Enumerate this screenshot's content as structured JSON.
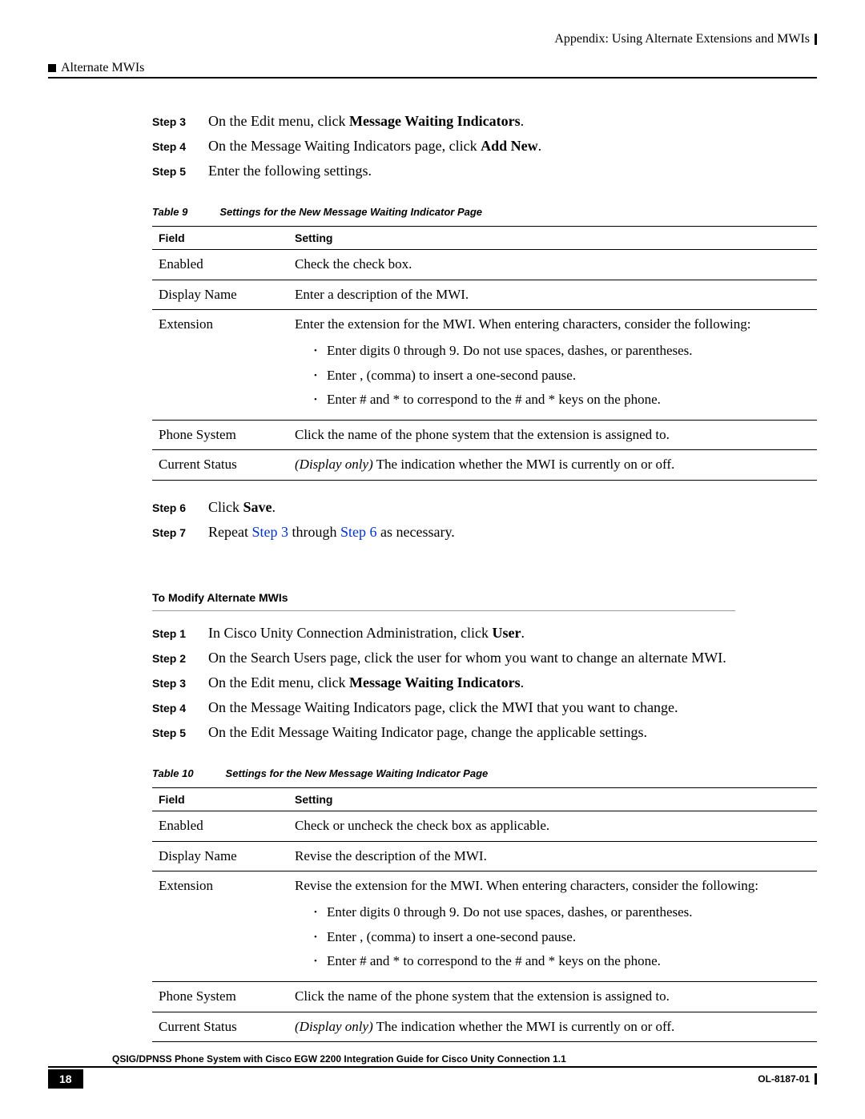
{
  "header": {
    "appendix": "Appendix: Using Alternate Extensions and MWIs",
    "section": "Alternate MWIs"
  },
  "steps_top": [
    {
      "label": "Step 3",
      "prefix": "On the Edit menu, click ",
      "bold": "Message Waiting Indicators",
      "suffix": "."
    },
    {
      "label": "Step 4",
      "prefix": "On the Message Waiting Indicators page, click ",
      "bold": "Add New",
      "suffix": "."
    },
    {
      "label": "Step 5",
      "prefix": "Enter the following settings.",
      "bold": "",
      "suffix": ""
    }
  ],
  "table9": {
    "caption_label": "Table 9",
    "caption": "Settings for the New Message Waiting Indicator Page",
    "head_field": "Field",
    "head_setting": "Setting",
    "rows": {
      "enabled": {
        "f": "Enabled",
        "s": "Check the check box."
      },
      "display": {
        "f": "Display Name",
        "s": "Enter a description of the MWI."
      },
      "ext": {
        "f": "Extension",
        "intro": "Enter the extension for the MWI. When entering characters, consider the following:",
        "b1": "Enter digits 0 through 9. Do not use spaces, dashes, or parentheses.",
        "b2": "Enter , (comma) to insert a one-second pause.",
        "b3": "Enter # and * to correspond to the # and * keys on the phone."
      },
      "phone": {
        "f": "Phone System",
        "s": "Click the name of the phone system that the extension is assigned to."
      },
      "status": {
        "f": "Current Status",
        "italic": "(Display only)",
        "rest": " The indication whether the MWI is currently on or off."
      }
    }
  },
  "steps_after_t9": {
    "s6": {
      "label": "Step 6",
      "prefix": "Click ",
      "bold": "Save",
      "suffix": "."
    },
    "s7": {
      "label": "Step 7",
      "prefix": "Repeat ",
      "link1": "Step 3",
      "mid": " through ",
      "link2": "Step 6",
      "suffix": " as necessary."
    }
  },
  "section2": {
    "heading": "To Modify Alternate MWIs",
    "steps": [
      {
        "label": "Step 1",
        "prefix": "In Cisco Unity Connection Administration, click ",
        "bold": "User",
        "suffix": "."
      },
      {
        "label": "Step 2",
        "prefix": "On the Search Users page, click the user for whom you want to change an alternate MWI.",
        "bold": "",
        "suffix": ""
      },
      {
        "label": "Step 3",
        "prefix": "On the Edit menu, click ",
        "bold": "Message Waiting Indicators",
        "suffix": "."
      },
      {
        "label": "Step 4",
        "prefix": "On the Message Waiting Indicators page, click the MWI that you want to change.",
        "bold": "",
        "suffix": ""
      },
      {
        "label": "Step 5",
        "prefix": "On the Edit Message Waiting Indicator page, change the applicable settings.",
        "bold": "",
        "suffix": ""
      }
    ]
  },
  "table10": {
    "caption_label": "Table 10",
    "caption": "Settings for the New Message Waiting Indicator Page",
    "head_field": "Field",
    "head_setting": "Setting",
    "rows": {
      "enabled": {
        "f": "Enabled",
        "s": "Check or uncheck the check box as applicable."
      },
      "display": {
        "f": "Display Name",
        "s": "Revise the description of the MWI."
      },
      "ext": {
        "f": "Extension",
        "intro": "Revise the extension for the MWI. When entering characters, consider the following:",
        "b1": "Enter digits 0 through 9. Do not use spaces, dashes, or parentheses.",
        "b2": "Enter , (comma) to insert a one-second pause.",
        "b3": "Enter # and * to correspond to the # and * keys on the phone."
      },
      "phone": {
        "f": "Phone System",
        "s": "Click the name of the phone system that the extension is assigned to."
      },
      "status": {
        "f": "Current Status",
        "italic": "(Display only)",
        "rest": " The indication whether the MWI is currently on or off."
      }
    }
  },
  "footer": {
    "title": "QSIG/DPNSS Phone System with Cisco EGW 2200 Integration Guide for Cisco Unity Connection 1.1",
    "page": "18",
    "docid": "OL-8187-01"
  }
}
